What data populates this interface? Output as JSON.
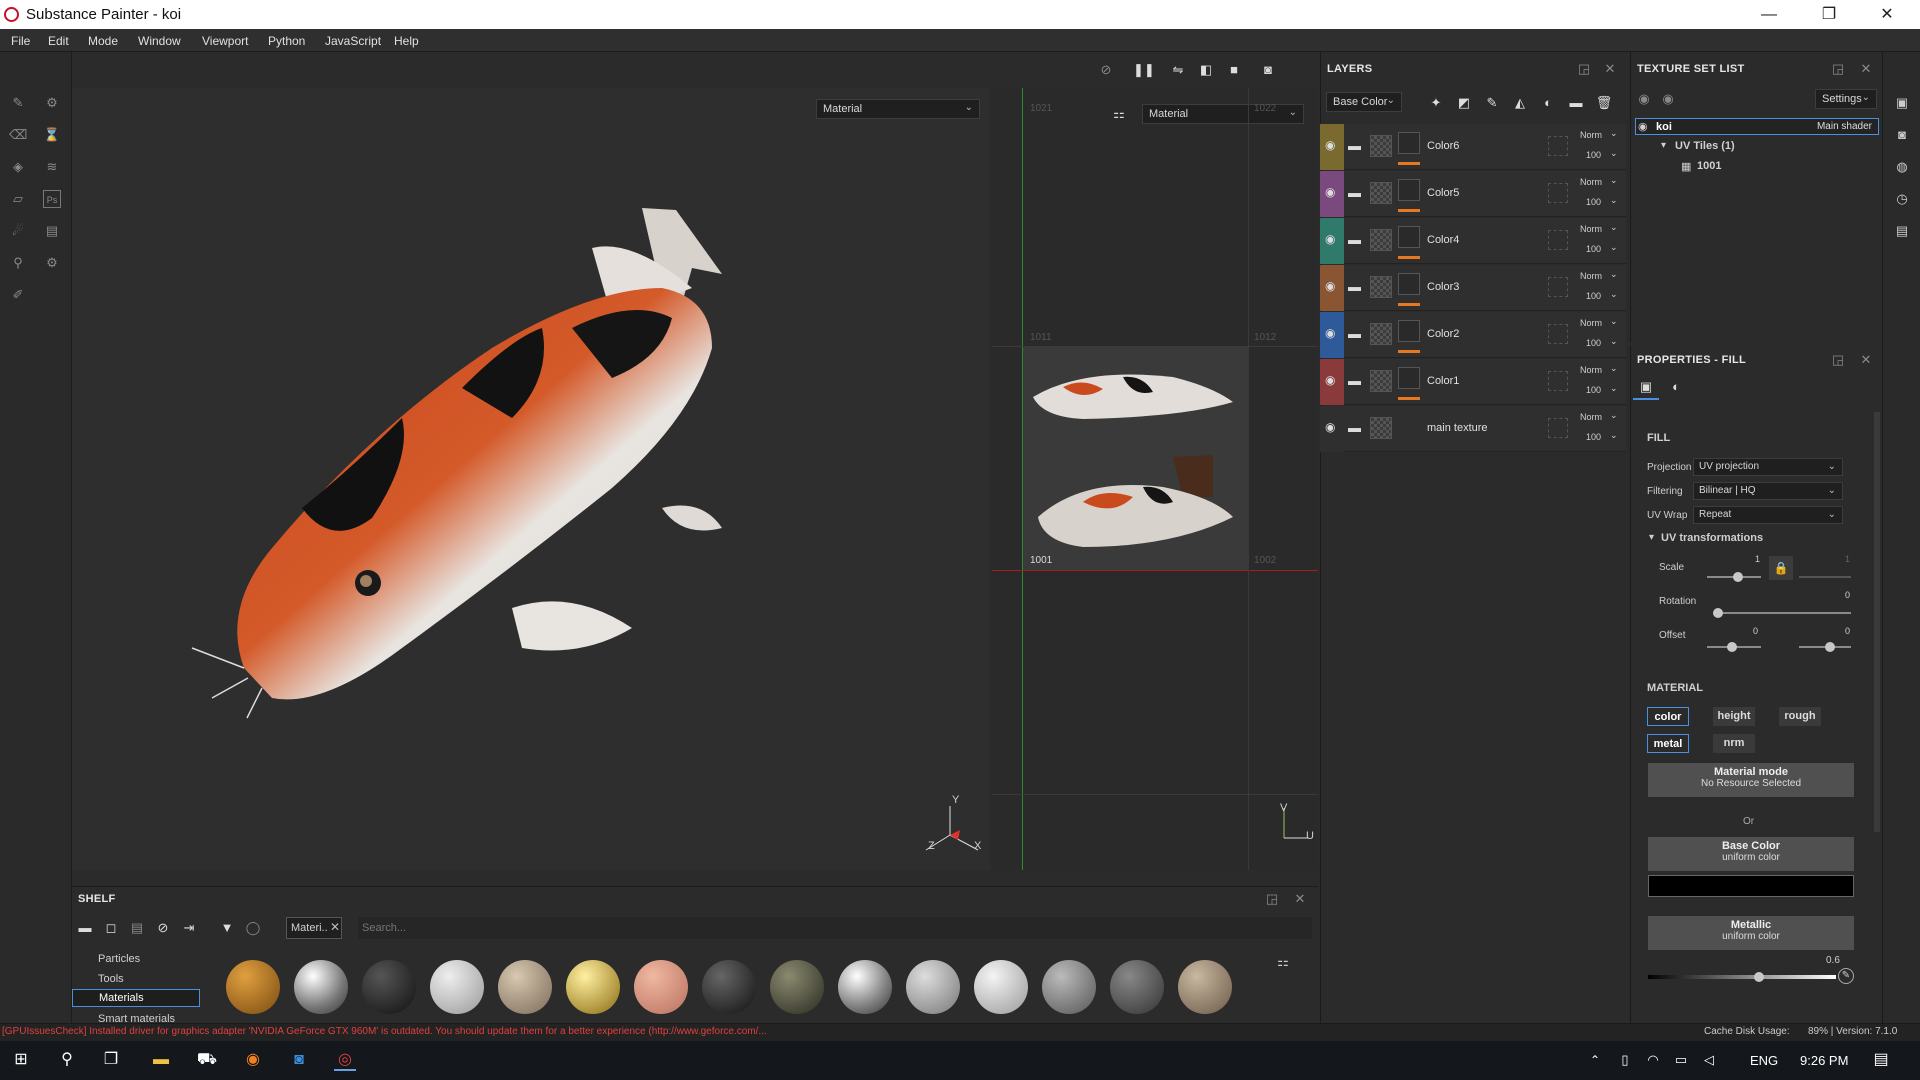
{
  "window": {
    "title": "Substance Painter - koi",
    "min": "—",
    "max": "❐",
    "close": "✕"
  },
  "menu": [
    "File",
    "Edit",
    "Mode",
    "Window",
    "Viewport",
    "Python",
    "JavaScript",
    "Help"
  ],
  "viewport": {
    "left_dropdown": "Material",
    "right_dropdown": "Material",
    "uv_tiles": [
      "1021",
      "1022",
      "1011",
      "1012",
      "1001",
      "1002"
    ],
    "axis_3d": {
      "y": "Y",
      "z": "Z",
      "x": "X"
    },
    "axis_uv": {
      "v": "V",
      "u": "U"
    }
  },
  "shelf": {
    "title": "SHELF",
    "filter_tag": "Materi..",
    "search_placeholder": "Search...",
    "categories": [
      "Particles",
      "Tools",
      "Materials",
      "Smart materials"
    ],
    "selected_category": "Materials"
  },
  "layers": {
    "title": "LAYERS",
    "channel": "Base Color",
    "items": [
      {
        "name": "Color6",
        "blend": "Norm",
        "opacity": "100",
        "color": "#7a6a30"
      },
      {
        "name": "Color5",
        "blend": "Norm",
        "opacity": "100",
        "color": "#7a4a7e"
      },
      {
        "name": "Color4",
        "blend": "Norm",
        "opacity": "100",
        "color": "#2f7a6a"
      },
      {
        "name": "Color3",
        "blend": "Norm",
        "opacity": "100",
        "color": "#8a5532"
      },
      {
        "name": "Color2",
        "blend": "Norm",
        "opacity": "100",
        "color": "#2f5a9a"
      },
      {
        "name": "Color1",
        "blend": "Norm",
        "opacity": "100",
        "color": "#8a3a3a"
      },
      {
        "name": "main texture",
        "blend": "Norm",
        "opacity": "100",
        "color": "#2f2f2f"
      }
    ]
  },
  "texture_set": {
    "title": "TEXTURE SET LIST",
    "settings": "Settings",
    "set_name": "koi",
    "shader": "Main shader",
    "uv_tiles": "UV Tiles (1)",
    "tile": "1001"
  },
  "properties": {
    "title": "PROPERTIES - FILL",
    "fill_section": "FILL",
    "projection_label": "Projection",
    "projection": "UV projection",
    "filtering_label": "Filtering",
    "filtering": "Bilinear | HQ",
    "uvwrap_label": "UV Wrap",
    "uvwrap": "Repeat",
    "uvtrans": "UV transformations",
    "scale_label": "Scale",
    "scale_val": "1",
    "scale_val2": "1",
    "rotation_label": "Rotation",
    "rotation_val": "0",
    "offset_label": "Offset",
    "offset_val1": "0",
    "offset_val2": "0",
    "material_section": "MATERIAL",
    "chips": [
      "color",
      "height",
      "rough",
      "metal",
      "nrm"
    ],
    "mat_mode": "Material mode",
    "mat_mode_sub": "No Resource Selected",
    "or": "Or",
    "base_color": "Base Color",
    "base_color_sub": "uniform color",
    "metallic": "Metallic",
    "metallic_sub": "uniform color",
    "metallic_val": "0.6"
  },
  "status": {
    "message": "[GPUIssuesCheck] Installed driver for graphics adapter 'NVIDIA GeForce GTX 960M' is outdated. You should update them for a better experience (http://www.geforce.com/...",
    "cache": "Cache Disk Usage:",
    "cache_val": "89% | Version: 7.1.0"
  },
  "taskbar": {
    "lang": "ENG",
    "time": "9:26 PM"
  },
  "colors": {
    "accent": "#4b90e0",
    "error": "#e04040",
    "bg": "#2b2b2b"
  }
}
